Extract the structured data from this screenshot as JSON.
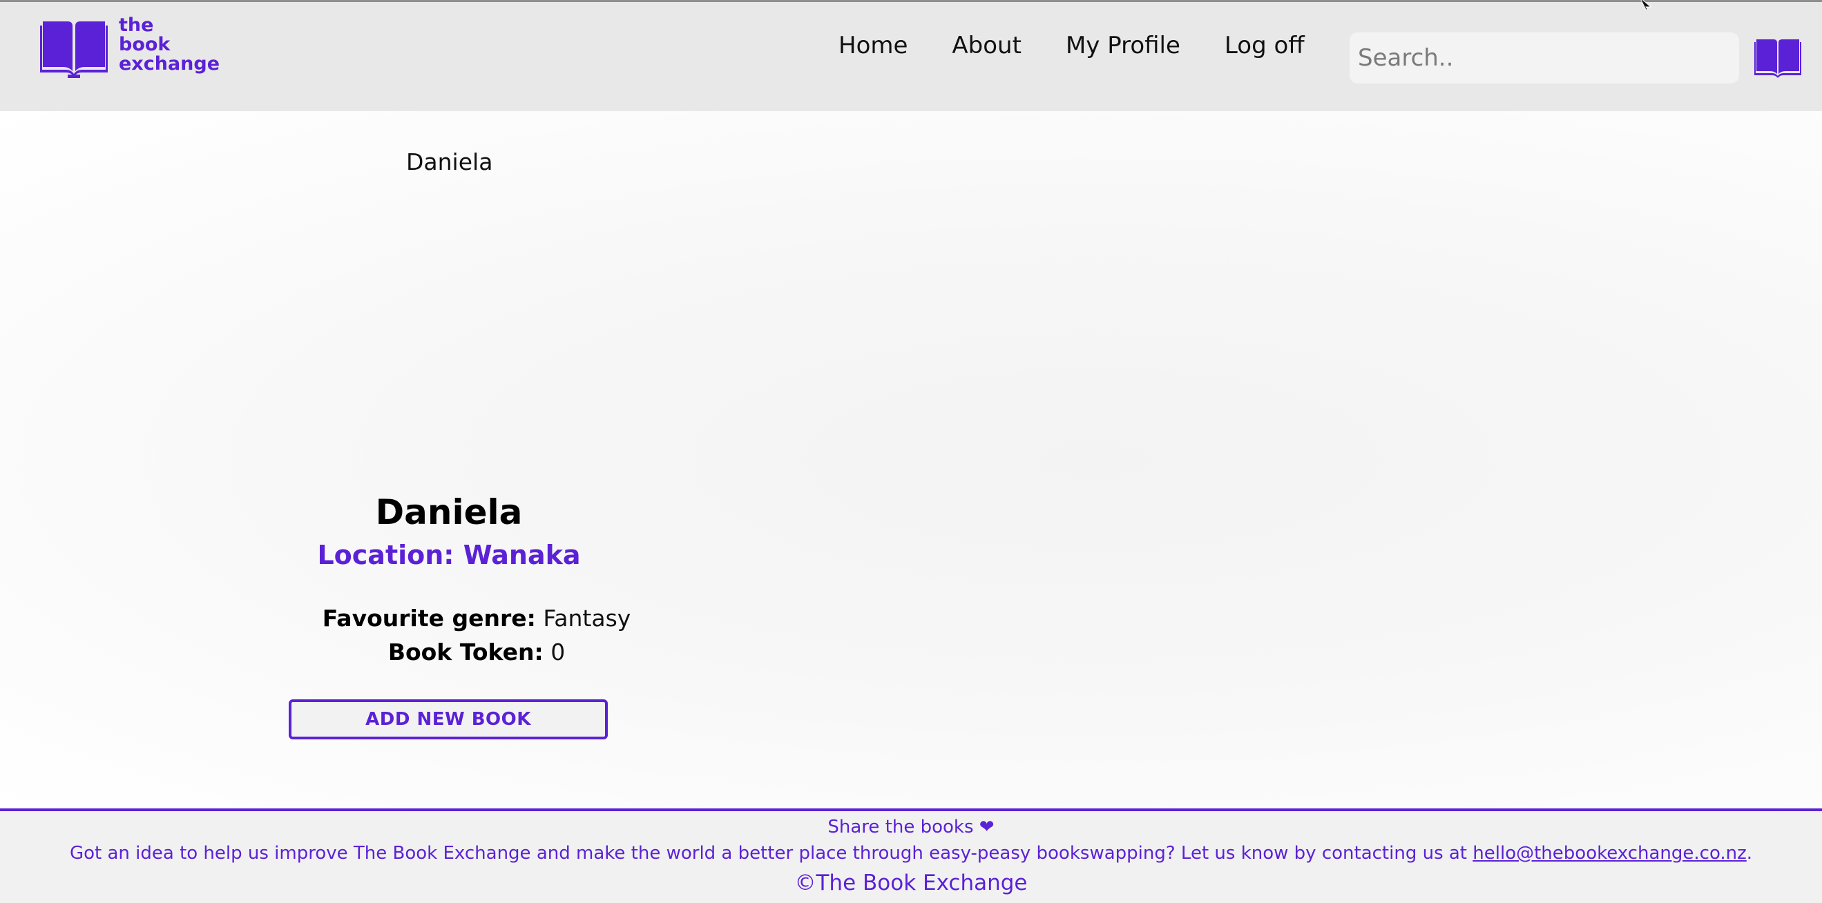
{
  "brand": {
    "logo_line1": "the",
    "logo_line2": "book",
    "logo_line3": "exchange",
    "color": "#5b21d6",
    "icon": "open-book-icon"
  },
  "nav": {
    "items": [
      {
        "label": "Home"
      },
      {
        "label": "About"
      },
      {
        "label": "My Profile"
      },
      {
        "label": "Log off"
      }
    ]
  },
  "search": {
    "placeholder": "Search..",
    "value": "",
    "button_icon": "open-book-icon"
  },
  "profile": {
    "image_alt": "Daniela",
    "name": "Daniela",
    "location_label": "Location: ",
    "location_value": "Wanaka",
    "genre_label": "Favourite genre:",
    "genre_value": "Fantasy",
    "token_label": "Book Token:",
    "token_value": "0",
    "add_book_label": "ADD NEW BOOK"
  },
  "footer": {
    "tagline": "Share the books ❤",
    "idea_text": "Got an idea to help us improve The Book Exchange and make the world a better place through easy-peasy bookswapping? Let us know by contacting us at ",
    "email": "hello@thebookexchange.co.nz",
    "idea_end": ".",
    "copyright": "©The Book Exchange"
  }
}
